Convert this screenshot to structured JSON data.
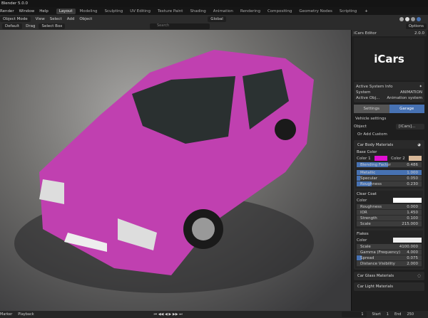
{
  "title": "Blender 5.0.0",
  "menu": [
    "Render",
    "Window",
    "Help"
  ],
  "workspaces": [
    "Layout",
    "Modeling",
    "Sculpting",
    "UV Editing",
    "Texture Paint",
    "Shading",
    "Animation",
    "Rendering",
    "Compositing",
    "Geometry Nodes",
    "Scripting"
  ],
  "active_workspace": "Layout",
  "header": {
    "mode": "Object Mode",
    "items": [
      "View",
      "Select",
      "Add",
      "Object"
    ],
    "orientation": "Global"
  },
  "toolheader": {
    "orientation_label": "Default",
    "drag_label": "Drag",
    "drag_value": "Select Box",
    "search_placeholder": "Search",
    "options": "Options"
  },
  "panel": {
    "editor_title": "iCars Editor",
    "version": "2.0.0",
    "logo": "iCars",
    "system_info": {
      "title": "Active System Info",
      "system_label": "System",
      "system_value": "ANIMATION",
      "active_label": "Active Obj...",
      "active_value": "Animation system"
    },
    "tabs": [
      "Settings",
      "Garage"
    ],
    "active_tab": "Garage",
    "vehicle_settings": "Vehicle settings",
    "object_label": "Object",
    "object_value": "[iCars]...",
    "add_custom": "Or Add Custom",
    "body": {
      "title": "Car Body Materials",
      "base_color": "Base Color",
      "color1": "Color 1",
      "color1_hex": "#e010d0",
      "color2": "Color 2",
      "blending_label": "Blending Factor",
      "blending_value": "0.486",
      "blending": 0.486,
      "fields": [
        {
          "label": "Metallic",
          "value": "1.000",
          "fill": 1.0
        },
        {
          "label": "Specular",
          "value": "0.050",
          "fill": 0.05
        },
        {
          "label": "Roughness",
          "value": "0.230",
          "fill": 0.23
        }
      ]
    },
    "clearcoat": {
      "title": "Clear Coat",
      "color_label": "Color",
      "fields": [
        {
          "label": "Roughness",
          "value": "0.000"
        },
        {
          "label": "IOR",
          "value": "1.450"
        },
        {
          "label": "Strength",
          "value": "0.100"
        },
        {
          "label": "Scale",
          "value": "215.000"
        }
      ]
    },
    "flakes": {
      "title": "Flakes",
      "color_label": "Color",
      "fields": [
        {
          "label": "Scale",
          "value": "4100.000",
          "fill": 0
        },
        {
          "label": "Gamma (Frequency)",
          "value": "4.000",
          "fill": 0
        },
        {
          "label": "Spread",
          "value": "0.075",
          "fill": 0.075
        },
        {
          "label": "Distance Visibility",
          "value": "2.000",
          "fill": 0
        }
      ]
    },
    "glass": "Car Glass Materials",
    "lights": "Car Light Materials"
  },
  "timeline": {
    "items": [
      "Marker",
      "Playback"
    ],
    "frame": "1",
    "start_label": "Start",
    "start": "1",
    "end_label": "End",
    "end": "250"
  },
  "colors": {
    "accent": "#4772b3",
    "car": "#c040b0"
  }
}
